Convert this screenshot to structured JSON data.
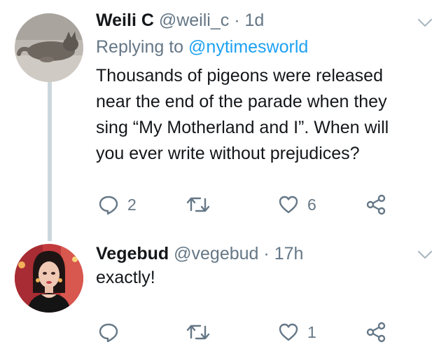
{
  "tweets": [
    {
      "name": "Weili C",
      "handle": "@weili_c",
      "separator": "·",
      "time": "1d",
      "reply_prefix": "Replying to",
      "reply_to": "@nytimesworld",
      "text": "Thousands of pigeons were released\nnear the end of the parade when they\nsing “My Motherland and I”. When will\nyou ever write without prejudices?",
      "actions": {
        "replies": "2",
        "retweets": "",
        "likes": "6"
      }
    },
    {
      "name": "Vegebud",
      "handle": "@vegebud",
      "separator": "·",
      "time": "17h",
      "text": "exactly!",
      "actions": {
        "replies": "",
        "retweets": "",
        "likes": "1"
      }
    }
  ],
  "icons": {
    "reply": "reply-icon",
    "retweet": "retweet-icon",
    "like": "heart-icon",
    "share": "share-icon",
    "more": "chevron-down-icon"
  },
  "colors": {
    "text": "#14171a",
    "secondary": "#657786",
    "link": "#1da1f2",
    "thread_line": "#ccd6dd"
  }
}
